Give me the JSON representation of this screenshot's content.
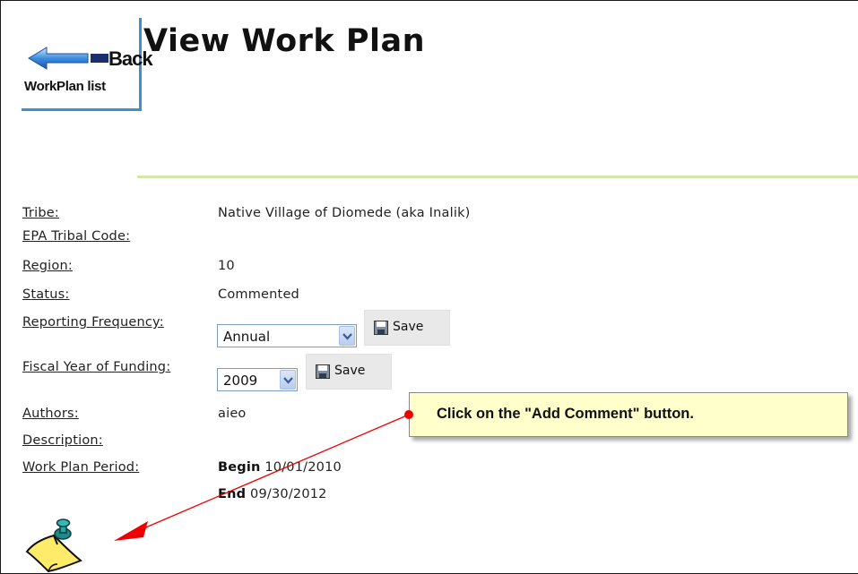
{
  "back": {
    "label": "Back",
    "sublabel": "WorkPlan list"
  },
  "page": {
    "title": "View Work Plan"
  },
  "fields": {
    "tribe_label": "Tribe:",
    "tribe_value": "Native Village of Diomede (aka Inalik)",
    "epa_label": "EPA Tribal Code:",
    "region_label": "Region:",
    "region_value": "10",
    "status_label": "Status:",
    "status_value": "Commented",
    "freq_label": "Reporting Frequency:",
    "freq_value": "Annual",
    "fy_label": "Fiscal Year of Funding:",
    "fy_value": "2009",
    "save_label": "Save",
    "authors_label": "Authors:",
    "authors_value": "aieo",
    "desc_label": "Description:",
    "period_label": "Work Plan Period:",
    "begin_label": "Begin",
    "begin_value": "10/01/2010",
    "end_label": "End",
    "end_value": "09/30/2012"
  },
  "callout": {
    "text": "Click on the \"Add Comment\" button."
  },
  "icons": {
    "back": "left-arrow-icon",
    "save": "floppy-disk-icon",
    "dropdown": "chevron-down-icon",
    "add_comment": "sticky-note-pushpin-icon"
  },
  "colors": {
    "rule": "#d2e8a4",
    "back_border": "#3b8fd6",
    "callout_bg": "#ffffcc",
    "arrow": "#ee0000"
  }
}
